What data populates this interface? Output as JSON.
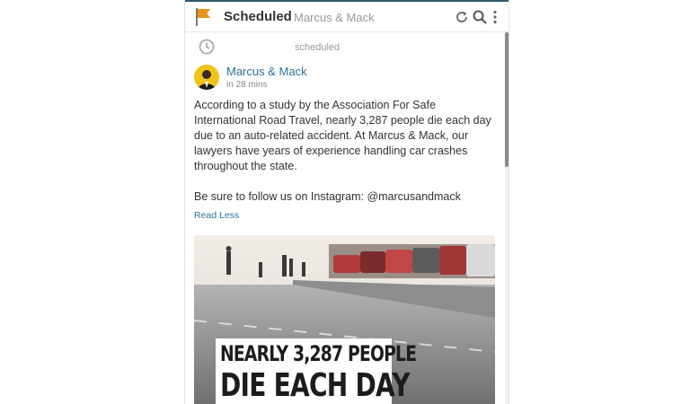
{
  "header": {
    "title": "Scheduled",
    "subtitle": "Marcus & Mack",
    "icons": [
      "flag-icon",
      "refresh-icon",
      "search-icon",
      "more-vert-icon"
    ],
    "accent_color": "#e8931a"
  },
  "post": {
    "status": "scheduled",
    "author": "Marcus & Mack",
    "time": "in 28 mins",
    "body": "According to a study by the Association For Safe International Road Travel, nearly 3,287 people die each day due to an auto-related accident. At Marcus & Mack, our lawyers have years of experience handling car crashes throughout the state.",
    "follow": "Be sure to follow us on Instagram: @marcusandmack",
    "read_less": "Read Less",
    "image": {
      "line1": "NEARLY 3,287 PEOPLE",
      "line2": "DIE EACH DAY"
    }
  }
}
